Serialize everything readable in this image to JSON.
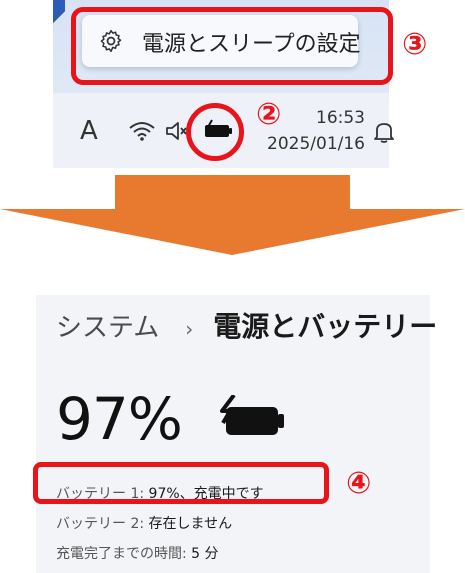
{
  "taskbar_panel": {
    "popup_label": "電源とスリープの設定",
    "ime_indicator": "A",
    "clock_time": "16:53",
    "clock_date": "2025/01/16",
    "icons": [
      "gear-icon",
      "wifi-icon",
      "speaker-muted-icon",
      "battery-charging-icon",
      "bell-icon"
    ]
  },
  "annotations": {
    "callout_battery_icon": "②",
    "callout_settings_popup": "③",
    "callout_battery_status": "④",
    "highlight_color": "#e8141a"
  },
  "arrow": {
    "color": "#e87a30"
  },
  "settings_page": {
    "breadcrumb_parent": "システム",
    "breadcrumb_separator": "›",
    "breadcrumb_current": "電源とバッテリー",
    "battery_percent": "97%",
    "battery_fill_fraction": 0.97,
    "battery1_label": "バッテリー 1:",
    "battery1_value": "97%、充電中です",
    "battery2_label": "バッテリー 2:",
    "battery2_value": "存在しません",
    "charge_time_label": "充電完了までの時間:",
    "charge_time_value": "5 分"
  }
}
